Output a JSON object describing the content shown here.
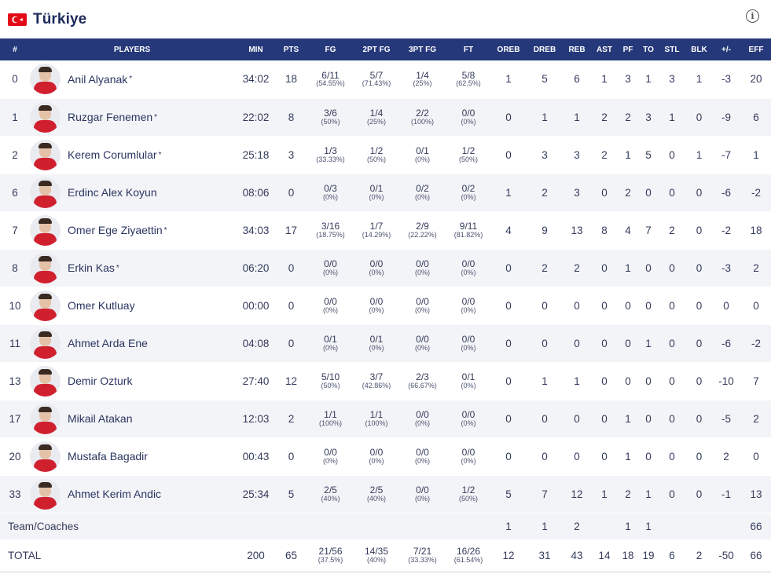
{
  "header": {
    "team_name": "Türkiye",
    "flag_icon": "turkey-flag-icon",
    "info_icon": "info-icon",
    "info_glyph": "i"
  },
  "colors": {
    "header_bg": "#25397a",
    "flag_red": "#e30a17",
    "text": "#1d2a5c"
  },
  "columns": [
    "#",
    "PLAYERS",
    "MIN",
    "PTS",
    "FG",
    "2PT FG",
    "3PT FG",
    "FT",
    "OREB",
    "DREB",
    "REB",
    "AST",
    "PF",
    "TO",
    "STL",
    "BLK",
    "+/-",
    "EFF"
  ],
  "players": [
    {
      "no": "0",
      "name": "Anil Alyanak",
      "starter": "*",
      "min": "34:02",
      "pts": "18",
      "fg": "6/11",
      "fg_pct": "(54.55%)",
      "fg2": "5/7",
      "fg2_pct": "(71.43%)",
      "fg3": "1/4",
      "fg3_pct": "(25%)",
      "ft": "5/8",
      "ft_pct": "(62.5%)",
      "oreb": "1",
      "dreb": "5",
      "reb": "6",
      "ast": "1",
      "pf": "3",
      "to": "1",
      "stl": "3",
      "blk": "1",
      "pm": "-3",
      "eff": "20"
    },
    {
      "no": "1",
      "name": "Ruzgar Fenemen",
      "starter": "*",
      "min": "22:02",
      "pts": "8",
      "fg": "3/6",
      "fg_pct": "(50%)",
      "fg2": "1/4",
      "fg2_pct": "(25%)",
      "fg3": "2/2",
      "fg3_pct": "(100%)",
      "ft": "0/0",
      "ft_pct": "(0%)",
      "oreb": "0",
      "dreb": "1",
      "reb": "1",
      "ast": "2",
      "pf": "2",
      "to": "3",
      "stl": "1",
      "blk": "0",
      "pm": "-9",
      "eff": "6"
    },
    {
      "no": "2",
      "name": "Kerem Corumlular",
      "starter": "*",
      "min": "25:18",
      "pts": "3",
      "fg": "1/3",
      "fg_pct": "(33.33%)",
      "fg2": "1/2",
      "fg2_pct": "(50%)",
      "fg3": "0/1",
      "fg3_pct": "(0%)",
      "ft": "1/2",
      "ft_pct": "(50%)",
      "oreb": "0",
      "dreb": "3",
      "reb": "3",
      "ast": "2",
      "pf": "1",
      "to": "5",
      "stl": "0",
      "blk": "1",
      "pm": "-7",
      "eff": "1"
    },
    {
      "no": "6",
      "name": "Erdinc Alex Koyun",
      "starter": "",
      "min": "08:06",
      "pts": "0",
      "fg": "0/3",
      "fg_pct": "(0%)",
      "fg2": "0/1",
      "fg2_pct": "(0%)",
      "fg3": "0/2",
      "fg3_pct": "(0%)",
      "ft": "0/2",
      "ft_pct": "(0%)",
      "oreb": "1",
      "dreb": "2",
      "reb": "3",
      "ast": "0",
      "pf": "2",
      "to": "0",
      "stl": "0",
      "blk": "0",
      "pm": "-6",
      "eff": "-2"
    },
    {
      "no": "7",
      "name": "Omer Ege Ziyaettin",
      "starter": "*",
      "min": "34:03",
      "pts": "17",
      "fg": "3/16",
      "fg_pct": "(18.75%)",
      "fg2": "1/7",
      "fg2_pct": "(14.29%)",
      "fg3": "2/9",
      "fg3_pct": "(22.22%)",
      "ft": "9/11",
      "ft_pct": "(81.82%)",
      "oreb": "4",
      "dreb": "9",
      "reb": "13",
      "ast": "8",
      "pf": "4",
      "to": "7",
      "stl": "2",
      "blk": "0",
      "pm": "-2",
      "eff": "18"
    },
    {
      "no": "8",
      "name": "Erkin Kas",
      "starter": "*",
      "min": "06:20",
      "pts": "0",
      "fg": "0/0",
      "fg_pct": "(0%)",
      "fg2": "0/0",
      "fg2_pct": "(0%)",
      "fg3": "0/0",
      "fg3_pct": "(0%)",
      "ft": "0/0",
      "ft_pct": "(0%)",
      "oreb": "0",
      "dreb": "2",
      "reb": "2",
      "ast": "0",
      "pf": "1",
      "to": "0",
      "stl": "0",
      "blk": "0",
      "pm": "-3",
      "eff": "2"
    },
    {
      "no": "10",
      "name": "Omer Kutluay",
      "starter": "",
      "min": "00:00",
      "pts": "0",
      "fg": "0/0",
      "fg_pct": "(0%)",
      "fg2": "0/0",
      "fg2_pct": "(0%)",
      "fg3": "0/0",
      "fg3_pct": "(0%)",
      "ft": "0/0",
      "ft_pct": "(0%)",
      "oreb": "0",
      "dreb": "0",
      "reb": "0",
      "ast": "0",
      "pf": "0",
      "to": "0",
      "stl": "0",
      "blk": "0",
      "pm": "0",
      "eff": "0"
    },
    {
      "no": "11",
      "name": "Ahmet Arda Ene",
      "starter": "",
      "min": "04:08",
      "pts": "0",
      "fg": "0/1",
      "fg_pct": "(0%)",
      "fg2": "0/1",
      "fg2_pct": "(0%)",
      "fg3": "0/0",
      "fg3_pct": "(0%)",
      "ft": "0/0",
      "ft_pct": "(0%)",
      "oreb": "0",
      "dreb": "0",
      "reb": "0",
      "ast": "0",
      "pf": "0",
      "to": "1",
      "stl": "0",
      "blk": "0",
      "pm": "-6",
      "eff": "-2"
    },
    {
      "no": "13",
      "name": "Demir Ozturk",
      "starter": "",
      "min": "27:40",
      "pts": "12",
      "fg": "5/10",
      "fg_pct": "(50%)",
      "fg2": "3/7",
      "fg2_pct": "(42.86%)",
      "fg3": "2/3",
      "fg3_pct": "(66.67%)",
      "ft": "0/1",
      "ft_pct": "(0%)",
      "oreb": "0",
      "dreb": "1",
      "reb": "1",
      "ast": "0",
      "pf": "0",
      "to": "0",
      "stl": "0",
      "blk": "0",
      "pm": "-10",
      "eff": "7"
    },
    {
      "no": "17",
      "name": "Mikail Atakan",
      "starter": "",
      "min": "12:03",
      "pts": "2",
      "fg": "1/1",
      "fg_pct": "(100%)",
      "fg2": "1/1",
      "fg2_pct": "(100%)",
      "fg3": "0/0",
      "fg3_pct": "(0%)",
      "ft": "0/0",
      "ft_pct": "(0%)",
      "oreb": "0",
      "dreb": "0",
      "reb": "0",
      "ast": "0",
      "pf": "1",
      "to": "0",
      "stl": "0",
      "blk": "0",
      "pm": "-5",
      "eff": "2"
    },
    {
      "no": "20",
      "name": "Mustafa Bagadir",
      "starter": "",
      "min": "00:43",
      "pts": "0",
      "fg": "0/0",
      "fg_pct": "(0%)",
      "fg2": "0/0",
      "fg2_pct": "(0%)",
      "fg3": "0/0",
      "fg3_pct": "(0%)",
      "ft": "0/0",
      "ft_pct": "(0%)",
      "oreb": "0",
      "dreb": "0",
      "reb": "0",
      "ast": "0",
      "pf": "1",
      "to": "0",
      "stl": "0",
      "blk": "0",
      "pm": "2",
      "eff": "0"
    },
    {
      "no": "33",
      "name": "Ahmet Kerim Andic",
      "starter": "",
      "min": "25:34",
      "pts": "5",
      "fg": "2/5",
      "fg_pct": "(40%)",
      "fg2": "2/5",
      "fg2_pct": "(40%)",
      "fg3": "0/0",
      "fg3_pct": "(0%)",
      "ft": "1/2",
      "ft_pct": "(50%)",
      "oreb": "5",
      "dreb": "7",
      "reb": "12",
      "ast": "1",
      "pf": "2",
      "to": "1",
      "stl": "0",
      "blk": "0",
      "pm": "-1",
      "eff": "13"
    }
  ],
  "team_coaches": {
    "label": "Team/Coaches",
    "oreb": "1",
    "dreb": "1",
    "reb": "2",
    "pf": "1",
    "to": "1",
    "eff": "66"
  },
  "totals": {
    "label": "TOTAL",
    "min": "200",
    "pts": "65",
    "fg": "21/56",
    "fg_pct": "(37.5%)",
    "fg2": "14/35",
    "fg2_pct": "(40%)",
    "fg3": "7/21",
    "fg3_pct": "(33.33%)",
    "ft": "16/26",
    "ft_pct": "(61.54%)",
    "oreb": "12",
    "dreb": "31",
    "reb": "43",
    "ast": "14",
    "pf": "18",
    "to": "19",
    "stl": "6",
    "blk": "2",
    "pm": "-50",
    "eff": "66"
  }
}
